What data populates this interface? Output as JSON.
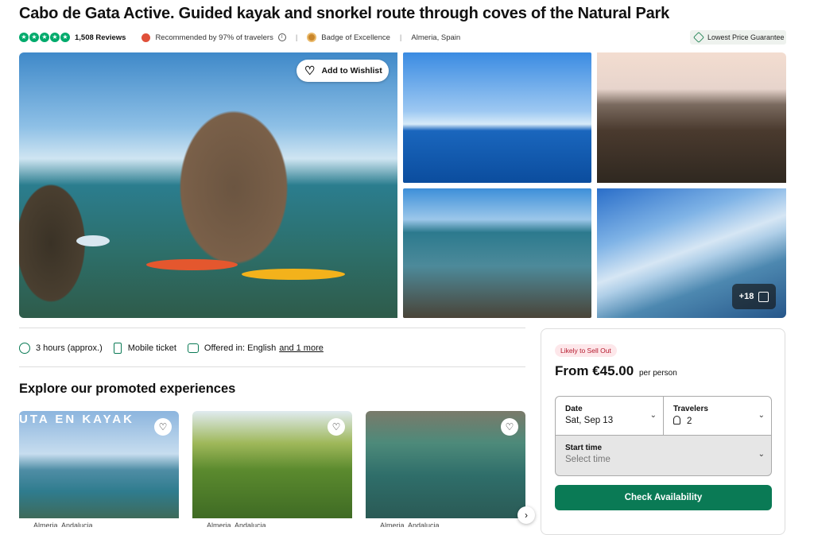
{
  "title": "Cabo de Gata Active. Guided kayak and snorkel route through coves of the Natural Park",
  "meta": {
    "rating_stars": 5,
    "reviews": "1,508 Reviews",
    "recommended": "Recommended by 97% of travelers",
    "badge": "Badge of Excellence",
    "location": "Almeria, Spain",
    "lowest_price": "Lowest Price Guarantee"
  },
  "gallery": {
    "wishlist_label": "Add to Wishlist",
    "more_photos": "+18"
  },
  "features": {
    "duration": "3 hours (approx.)",
    "ticket": "Mobile ticket",
    "offered_in": "Offered in: English",
    "more_languages": "and 1 more"
  },
  "promoted": {
    "title": "Explore our promoted experiences",
    "cards": [
      {
        "banner": "UTA EN KAYAK",
        "location": "Almeria, Andalucia"
      },
      {
        "location": "Almeria, Andalucia"
      },
      {
        "location": "Almeria, Andalucia"
      }
    ]
  },
  "booking": {
    "urgency": "Likely to Sell Out",
    "price": "From €45.00",
    "per": "per person",
    "date_label": "Date",
    "date_value": "Sat, Sep 13",
    "travelers_label": "Travelers",
    "travelers_value": "2",
    "time_label": "Start time",
    "time_placeholder": "Select time",
    "cta": "Check Availability"
  },
  "colors": {
    "brand_green": "#0a7a55",
    "star_green": "#00aa6c",
    "urgency_red": "#b5192d"
  }
}
